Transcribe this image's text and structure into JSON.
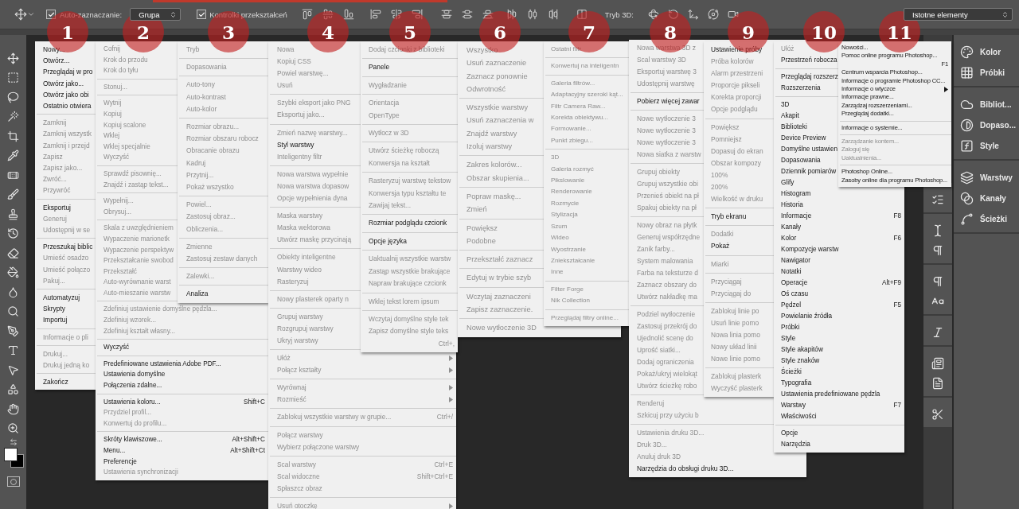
{
  "options_bar": {
    "auto_select": {
      "label": "Auto-zaznaczanie:",
      "checked": true
    },
    "auto_select_target": "Grupa",
    "transform_controls": {
      "label": "Kontrolki przekształceń",
      "checked": true
    },
    "mode_3d_label": "Tryb 3D:",
    "workspace": "Istotne elementy"
  },
  "annotations": [
    "1",
    "2",
    "3",
    "4",
    "5",
    "6",
    "7",
    "8",
    "9",
    "10",
    "11"
  ],
  "menus": [
    {
      "groups": [
        [
          {
            "label": "Nowy...",
            "disabled": false
          },
          {
            "label": "Otwórz...",
            "disabled": false
          },
          {
            "label": "Przeglądaj w pro",
            "disabled": false
          },
          {
            "label": "Otwórz jako...",
            "disabled": false
          },
          {
            "label": "Otwórz jako obi",
            "disabled": false
          },
          {
            "label": "Ostatnio otwiera",
            "disabled": false
          }
        ],
        [
          {
            "label": "Zamknij",
            "disabled": true
          },
          {
            "label": "Zamknij wszystk",
            "disabled": true
          },
          {
            "label": "Zamknij i przejd",
            "disabled": true
          },
          {
            "label": "Zapisz",
            "disabled": true
          },
          {
            "label": "Zapisz jako...",
            "disabled": true
          },
          {
            "label": "Zwróć...",
            "disabled": true
          },
          {
            "label": "Przywróć",
            "disabled": true
          }
        ],
        [
          {
            "label": "Eksportuj",
            "disabled": false
          },
          {
            "label": "Generuj",
            "disabled": true
          },
          {
            "label": "Udostępnij w se",
            "disabled": true
          }
        ],
        [
          {
            "label": "Przeszukaj biblic",
            "disabled": false
          },
          {
            "label": "Umieść osadzo",
            "disabled": true
          },
          {
            "label": "Umieść połączo",
            "disabled": true
          },
          {
            "label": "Pakuj...",
            "disabled": true
          }
        ],
        [
          {
            "label": "Automatyzuj",
            "disabled": false
          },
          {
            "label": "Skrypty",
            "disabled": false
          },
          {
            "label": "Importuj",
            "disabled": false
          }
        ],
        [
          {
            "label": "Informacje o pli",
            "disabled": true
          }
        ],
        [
          {
            "label": "Drukuj...",
            "disabled": true
          },
          {
            "label": "Drukuj jedną ko",
            "disabled": true
          }
        ],
        [
          {
            "label": "Zakończ",
            "disabled": false
          }
        ]
      ]
    },
    {
      "groups": [
        [
          {
            "label": "Cofnij",
            "disabled": true
          },
          {
            "label": "Krok do przodu",
            "disabled": true
          },
          {
            "label": "Krok do tyłu",
            "disabled": true
          }
        ],
        [
          {
            "label": "Stonuj...",
            "disabled": true
          }
        ],
        [
          {
            "label": "Wytnij",
            "disabled": true
          },
          {
            "label": "Kopiuj",
            "disabled": true
          },
          {
            "label": "Kopiuj scalone",
            "disabled": true
          },
          {
            "label": "Wklej",
            "disabled": true
          },
          {
            "label": "Wklej specjalnie",
            "disabled": true
          },
          {
            "label": "Wyczyść",
            "disabled": true
          }
        ],
        [
          {
            "label": "Sprawdź pisownię...",
            "disabled": true
          },
          {
            "label": "Znajdź i zastąp tekst...",
            "disabled": true
          }
        ],
        [
          {
            "label": "Wypełnij...",
            "disabled": true
          },
          {
            "label": "Obrysuj...",
            "disabled": true
          }
        ],
        [
          {
            "label": "Skala z uwzględnieniem",
            "disabled": true
          },
          {
            "label": "Wypaczenie marionetk",
            "disabled": true
          },
          {
            "label": "Wypaczenie perspektyw",
            "disabled": true
          },
          {
            "label": "Przekształcanie swobod",
            "disabled": true
          },
          {
            "label": "Przekształć",
            "disabled": true
          },
          {
            "label": "Auto-wyrównanie warst",
            "disabled": true
          },
          {
            "label": "Auto-mieszanie warstw",
            "disabled": true
          }
        ],
        [
          {
            "label": "Zdefiniuj ustawienie domyślne pędzla...",
            "disabled": true
          },
          {
            "label": "Zdefiniuj wzorek...",
            "disabled": true
          },
          {
            "label": "Zdefiniuj kształt własny...",
            "disabled": true
          }
        ],
        [
          {
            "label": "Wyczyść",
            "disabled": false
          }
        ],
        [
          {
            "label": "Predefiniowane ustawienia Adobe PDF...",
            "disabled": false
          },
          {
            "label": "Ustawienia domyślne",
            "disabled": false
          },
          {
            "label": "Połączenia zdalne...",
            "disabled": false
          }
        ],
        [
          {
            "label": "Ustawienia koloru...",
            "disabled": false,
            "shortcut": "Shift+C"
          },
          {
            "label": "Przydziel profil...",
            "disabled": true
          },
          {
            "label": "Konwertuj do profilu...",
            "disabled": true
          }
        ],
        [
          {
            "label": "Skróty klawiszowe...",
            "disabled": false,
            "shortcut": "Alt+Shift+C"
          },
          {
            "label": "Menu...",
            "disabled": false,
            "shortcut": "Alt+Shift+Ct"
          },
          {
            "label": "Preferencje",
            "disabled": false
          },
          {
            "label": "Ustawienia synchronizacji",
            "disabled": true
          }
        ]
      ]
    },
    {
      "groups": [
        [
          {
            "label": "Tryb",
            "disabled": true
          }
        ],
        [
          {
            "label": "Dopasowania",
            "disabled": true
          }
        ],
        [
          {
            "label": "Auto-tony",
            "disabled": true
          },
          {
            "label": "Auto-kontrast",
            "disabled": true
          },
          {
            "label": "Auto-kolor",
            "disabled": true
          }
        ],
        [
          {
            "label": "Rozmiar obrazu...",
            "disabled": true
          },
          {
            "label": "Rozmiar obszaru robocz",
            "disabled": true
          },
          {
            "label": "Obracanie obrazu",
            "disabled": true
          },
          {
            "label": "Kadruj",
            "disabled": true
          },
          {
            "label": "Przytnij...",
            "disabled": true
          },
          {
            "label": "Pokaż wszystko",
            "disabled": true
          }
        ],
        [
          {
            "label": "Powiel...",
            "disabled": true
          },
          {
            "label": "Zastosuj obraz...",
            "disabled": true
          },
          {
            "label": "Obliczenia...",
            "disabled": true
          }
        ],
        [
          {
            "label": "Zmienne",
            "disabled": true
          },
          {
            "label": "Zastosuj zestaw danych",
            "disabled": true
          }
        ],
        [
          {
            "label": "Zalewki...",
            "disabled": true
          }
        ],
        [
          {
            "label": "Analiza",
            "disabled": false
          }
        ]
      ]
    },
    {
      "groups": [
        [
          {
            "label": "Nowa",
            "disabled": true
          },
          {
            "label": "Kopiuj CSS",
            "disabled": true
          },
          {
            "label": "Powiel warstwę...",
            "disabled": true
          },
          {
            "label": "Usuń",
            "disabled": true
          }
        ],
        [
          {
            "label": "Szybki eksport jako PNG",
            "disabled": true
          },
          {
            "label": "Eksportuj jako...",
            "disabled": true
          }
        ],
        [
          {
            "label": "Zmień nazwę warstwy...",
            "disabled": true
          },
          {
            "label": "Styl warstwy",
            "disabled": false
          },
          {
            "label": "Inteligentny filtr",
            "disabled": true
          }
        ],
        [
          {
            "label": "Nowa warstwa wypełnie",
            "disabled": true
          },
          {
            "label": "Nowa warstwa dopasow",
            "disabled": true
          },
          {
            "label": "Opcje wypełnienia dyna",
            "disabled": true
          }
        ],
        [
          {
            "label": "Maska warstwy",
            "disabled": true
          },
          {
            "label": "Maska wektorowa",
            "disabled": true
          },
          {
            "label": "Utwórz maskę przycinają",
            "disabled": true
          }
        ],
        [
          {
            "label": "Obiekty inteligentne",
            "disabled": true
          },
          {
            "label": "Warstwy wideo",
            "disabled": true
          },
          {
            "label": "Rasteryzuj",
            "disabled": true
          }
        ],
        [
          {
            "label": "Nowy plasterek oparty n",
            "disabled": true
          }
        ],
        [
          {
            "label": "Grupuj warstwy",
            "disabled": true
          },
          {
            "label": "Rozgrupuj warstwy",
            "disabled": true
          },
          {
            "label": "Ukryj warstwy",
            "disabled": true
          }
        ],
        [
          {
            "label": "Ułóż",
            "disabled": true,
            "submenu": true
          },
          {
            "label": "Połącz kształty",
            "disabled": true,
            "submenu": true
          }
        ],
        [
          {
            "label": "Wyrównaj",
            "disabled": true,
            "submenu": true
          },
          {
            "label": "Rozmieść",
            "disabled": true,
            "submenu": true
          }
        ],
        [
          {
            "label": "Zablokuj wszystkie warstwy w grupie...",
            "disabled": true,
            "shortcut": "Ctrl+/"
          }
        ],
        [
          {
            "label": "Połącz warstwy",
            "disabled": true
          },
          {
            "label": "Wybierz połączone warstwy",
            "disabled": true
          }
        ],
        [
          {
            "label": "Scal warstwy",
            "disabled": true,
            "shortcut": "Ctrl+E"
          },
          {
            "label": "Scal widoczne",
            "disabled": true,
            "shortcut": "Shift+Ctrl+E"
          },
          {
            "label": "Spłaszcz obraz",
            "disabled": true
          }
        ],
        [
          {
            "label": "Usuń otoczkę",
            "disabled": true,
            "submenu": true
          }
        ]
      ]
    },
    {
      "groups": [
        [
          {
            "label": "Dodaj czcionki z biblioteki",
            "disabled": true
          }
        ],
        [
          {
            "label": "Panele",
            "disabled": false
          }
        ],
        [
          {
            "label": "Wygładzanie",
            "disabled": true
          }
        ],
        [
          {
            "label": "Orientacja",
            "disabled": true
          },
          {
            "label": "OpenType",
            "disabled": true
          }
        ],
        [
          {
            "label": "Wytłocz w 3D",
            "disabled": true
          }
        ],
        [
          {
            "label": "Utwórz ścieżkę roboczą",
            "disabled": true
          },
          {
            "label": "Konwersja na kształt",
            "disabled": true
          }
        ],
        [
          {
            "label": "Rasteryzuj warstwę tekstow",
            "disabled": true
          },
          {
            "label": "Konwersja typu kształtu te",
            "disabled": true
          },
          {
            "label": "Zawijaj tekst...",
            "disabled": true
          }
        ],
        [
          {
            "label": "Rozmiar podglądu czcionk",
            "disabled": false
          }
        ],
        [
          {
            "label": "Opcje języka",
            "disabled": false
          }
        ],
        [
          {
            "label": "Uaktualnij wszystkie warstw",
            "disabled": true
          },
          {
            "label": "Zastąp wszystkie brakujące",
            "disabled": true
          },
          {
            "label": "Napraw brakujące czcionk",
            "disabled": true
          }
        ],
        [
          {
            "label": "Wklej tekst lorem ipsum",
            "disabled": true
          }
        ],
        [
          {
            "label": "Wczytaj domyślne style tek",
            "disabled": true
          },
          {
            "label": "Zapisz domyślne style teks",
            "disabled": true,
            "shortcut": "Ctrl+,"
          }
        ]
      ]
    },
    {
      "groups": [
        [
          {
            "label": "Wszystko",
            "disabled": true
          },
          {
            "label": "Usuń zaznaczenie",
            "disabled": true
          },
          {
            "label": "Zaznacz ponownie",
            "disabled": true
          },
          {
            "label": "Odwrotność",
            "disabled": true
          }
        ],
        [
          {
            "label": "Wszystkie warstwy",
            "disabled": true
          },
          {
            "label": "Usuń zaznaczenia w",
            "disabled": true
          },
          {
            "label": "Znajdź warstwy",
            "disabled": true
          },
          {
            "label": "Izoluj warstwy",
            "disabled": true
          }
        ],
        [
          {
            "label": "Zakres kolorów...",
            "disabled": true
          },
          {
            "label": "Obszar skupienia...",
            "disabled": true
          }
        ],
        [
          {
            "label": "Popraw maskę...",
            "disabled": true
          },
          {
            "label": "Zmień",
            "disabled": true
          }
        ],
        [
          {
            "label": "Powiększ",
            "disabled": true
          },
          {
            "label": "Podobne",
            "disabled": true
          }
        ],
        [
          {
            "label": "Przekształć zaznacz",
            "disabled": true
          }
        ],
        [
          {
            "label": "Edytuj w trybie szyb",
            "disabled": true
          }
        ],
        [
          {
            "label": "Wczytaj zaznaczeni",
            "disabled": true
          },
          {
            "label": "Zapisz zaznaczenie.",
            "disabled": true
          }
        ],
        [
          {
            "label": "Nowe wytłoczenie 3D",
            "disabled": true
          }
        ]
      ]
    },
    {
      "groups": [
        [
          {
            "label": "Ostatni filtr",
            "disabled": true
          }
        ],
        [
          {
            "label": "Konwertuj na inteligentn",
            "disabled": true
          }
        ],
        [
          {
            "label": "Galeria filtrów...",
            "disabled": true
          },
          {
            "label": "Adaptacyjny szeroki kąt...",
            "disabled": true
          },
          {
            "label": "Filtr Camera Raw...",
            "disabled": true
          },
          {
            "label": "Korekta obiektywu...",
            "disabled": true
          },
          {
            "label": "Formowanie...",
            "disabled": true
          },
          {
            "label": "Punkt zbiegu...",
            "disabled": true
          }
        ],
        [
          {
            "label": "3D",
            "disabled": true
          },
          {
            "label": "Galeria rozmyć",
            "disabled": true
          },
          {
            "label": "Pikslowanie",
            "disabled": true
          },
          {
            "label": "Renderowanie",
            "disabled": true
          },
          {
            "label": "Rozmycie",
            "disabled": true
          },
          {
            "label": "Stylizacja",
            "disabled": true
          },
          {
            "label": "Szum",
            "disabled": true
          },
          {
            "label": "Wideo",
            "disabled": true
          },
          {
            "label": "Wyostrzanie",
            "disabled": true
          },
          {
            "label": "Zniekształcanie",
            "disabled": true
          },
          {
            "label": "Inne",
            "disabled": true
          }
        ],
        [
          {
            "label": "Filter Forge",
            "disabled": true
          },
          {
            "label": "Nik Collection",
            "disabled": true
          }
        ],
        [
          {
            "label": "Przeglądaj filtry online...",
            "disabled": true
          }
        ]
      ]
    },
    {
      "groups": [
        [
          {
            "label": "Nowa warstwa 3D z",
            "disabled": true
          },
          {
            "label": "Scal warstwy 3D",
            "disabled": true
          },
          {
            "label": "Eksportuj warstwę 3",
            "disabled": true
          },
          {
            "label": "Udostępnij warstwę",
            "disabled": true
          }
        ],
        [
          {
            "label": "Pobierz więcej zawar",
            "disabled": false
          }
        ],
        [
          {
            "label": "Nowe wytłoczenie 3",
            "disabled": true
          },
          {
            "label": "Nowe wytłoczenie 3",
            "disabled": true
          },
          {
            "label": "Nowe wytłoczenie 3",
            "disabled": true
          },
          {
            "label": "Nowa siatka z warstw",
            "disabled": true
          }
        ],
        [
          {
            "label": "Grupuj obiekty",
            "disabled": true
          },
          {
            "label": "Grupuj wszystkie obi",
            "disabled": true
          },
          {
            "label": "Przenieś obiekt na pł",
            "disabled": true
          },
          {
            "label": "Spakuj obiekty na pł",
            "disabled": true
          }
        ],
        [
          {
            "label": "Nowy obraz na płytk",
            "disabled": true
          },
          {
            "label": "Generuj współrzędne",
            "disabled": true
          },
          {
            "label": "Zanik farby...",
            "disabled": true
          },
          {
            "label": "System malowania",
            "disabled": true
          },
          {
            "label": "Farba na teksturze d",
            "disabled": true
          },
          {
            "label": "Zaznacz obszary do",
            "disabled": true
          },
          {
            "label": "Utwórz nakładkę ma",
            "disabled": true
          }
        ],
        [
          {
            "label": "Podziel wytłoczenie",
            "disabled": true
          },
          {
            "label": "Zastosuj przekrój do",
            "disabled": true
          },
          {
            "label": "Ujednolić scenę do",
            "disabled": true
          },
          {
            "label": "Uprość siatki...",
            "disabled": true
          },
          {
            "label": "Dodaj ograniczenia",
            "disabled": true
          },
          {
            "label": "Pokaż/ukryj wielokąt",
            "disabled": true
          },
          {
            "label": "Utwórz ścieżkę robo",
            "disabled": true
          }
        ],
        [
          {
            "label": "Renderuj",
            "disabled": true
          },
          {
            "label": "Szkicuj przy użyciu b",
            "disabled": true
          }
        ],
        [
          {
            "label": "Ustawienia druku 3D...",
            "disabled": true
          },
          {
            "label": "Druk 3D...",
            "disabled": true
          },
          {
            "label": "Anuluj druk 3D",
            "disabled": true
          },
          {
            "label": "Narzędzia do obsługi druku 3D...",
            "disabled": false
          }
        ]
      ]
    },
    {
      "groups": [
        [
          {
            "label": "Ustawienie próby",
            "disabled": false
          },
          {
            "label": "Próba kolorów",
            "disabled": true
          },
          {
            "label": "Alarm przestrzeni",
            "disabled": true
          },
          {
            "label": "Proporcje pikseli",
            "disabled": true
          },
          {
            "label": "Korekta proporcji",
            "disabled": true
          },
          {
            "label": "Opcje podglądu",
            "disabled": true
          }
        ],
        [
          {
            "label": "Powiększ",
            "disabled": true
          },
          {
            "label": "Pomniejsz",
            "disabled": true
          },
          {
            "label": "Dopasuj do ekran",
            "disabled": true
          },
          {
            "label": "Obszar kompozy",
            "disabled": true
          },
          {
            "label": "100%",
            "disabled": true
          },
          {
            "label": "200%",
            "disabled": true
          },
          {
            "label": "Wielkość w druku",
            "disabled": true
          }
        ],
        [
          {
            "label": "Tryb ekranu",
            "disabled": false
          }
        ],
        [
          {
            "label": "Dodatki",
            "disabled": true
          },
          {
            "label": "Pokaż",
            "disabled": false
          }
        ],
        [
          {
            "label": "Miarki",
            "disabled": true
          }
        ],
        [
          {
            "label": "Przyciągaj",
            "disabled": true
          },
          {
            "label": "Przyciągaj do",
            "disabled": true
          }
        ],
        [
          {
            "label": "Zablokuj linie po",
            "disabled": true
          },
          {
            "label": "Usuń linie pomo",
            "disabled": true
          },
          {
            "label": "Nowa linia pomo",
            "disabled": true
          },
          {
            "label": "Nowy układ linii",
            "disabled": true
          },
          {
            "label": "Nowe linie pomo",
            "disabled": true
          }
        ],
        [
          {
            "label": "Zablokuj plasterk",
            "disabled": true
          },
          {
            "label": "Wyczyść plasterk",
            "disabled": true
          }
        ]
      ]
    },
    {
      "groups": [
        [
          {
            "label": "Ułóż",
            "disabled": true
          },
          {
            "label": "Przestrzeń robocza",
            "disabled": false
          }
        ],
        [
          {
            "label": "Przeglądaj rozszerz",
            "disabled": false
          },
          {
            "label": "Rozszerzenia",
            "disabled": false
          }
        ],
        [
          {
            "label": "3D",
            "disabled": false
          },
          {
            "label": "Akapit",
            "disabled": false
          },
          {
            "label": "Biblioteki",
            "disabled": false
          },
          {
            "label": "Device Preview",
            "disabled": false
          },
          {
            "label": "Domyślne ustawien",
            "disabled": false
          },
          {
            "label": "Dopasowania",
            "disabled": false
          },
          {
            "label": "Dziennik pomiarów",
            "disabled": false
          },
          {
            "label": "Glify",
            "disabled": false
          },
          {
            "label": "Histogram",
            "disabled": false
          },
          {
            "label": "Historia",
            "disabled": false
          },
          {
            "label": "Informacje",
            "disabled": false,
            "shortcut": "F8"
          },
          {
            "label": "Kanały",
            "disabled": false
          },
          {
            "label": "Kolor",
            "disabled": false,
            "shortcut": "F6"
          },
          {
            "label": "Kompozycje warstw",
            "disabled": false
          },
          {
            "label": "Nawigator",
            "disabled": false
          },
          {
            "label": "Notatki",
            "disabled": false
          },
          {
            "label": "Operacje",
            "disabled": false,
            "shortcut": "Alt+F9"
          },
          {
            "label": "Oś czasu",
            "disabled": false
          },
          {
            "label": "Pędzel",
            "disabled": false,
            "shortcut": "F5"
          },
          {
            "label": "Powielanie źródła",
            "disabled": false
          },
          {
            "label": "Próbki",
            "disabled": false
          },
          {
            "label": "Style",
            "disabled": false
          },
          {
            "label": "Style akapitów",
            "disabled": false
          },
          {
            "label": "Style znaków",
            "disabled": false
          },
          {
            "label": "Ścieżki",
            "disabled": false
          },
          {
            "label": "Typografia",
            "disabled": false
          },
          {
            "label": "Ustawienia predefiniowane pędzla",
            "disabled": false
          },
          {
            "label": "Warstwy",
            "disabled": false,
            "shortcut": "F7"
          },
          {
            "label": "Właściwości",
            "disabled": false
          }
        ],
        [
          {
            "label": "Opcje",
            "disabled": false
          },
          {
            "label": "Narzędzia",
            "disabled": false
          }
        ]
      ]
    },
    {
      "groups": [
        [
          {
            "label": "Nowości...",
            "disabled": false
          },
          {
            "label": "Pomoc online programu Photoshop...",
            "disabled": false,
            "shortcut": "F1"
          },
          {
            "label": "Centrum wsparcia Photoshop...",
            "disabled": false
          },
          {
            "label": "Informacje o programie Photoshop CC...",
            "disabled": false
          },
          {
            "label": "Informacje o wtyczce",
            "disabled": false,
            "submenu": true
          },
          {
            "label": "Informacje prawne...",
            "disabled": false
          },
          {
            "label": "Zarządzaj rozszerzeniami...",
            "disabled": false
          },
          {
            "label": "Przeglądaj dodatki...",
            "disabled": false
          }
        ],
        [
          {
            "label": "Informacje o systemie...",
            "disabled": false
          }
        ],
        [
          {
            "label": "Zarządzanie kontem...",
            "disabled": true
          },
          {
            "label": "Zaloguj się",
            "disabled": true
          },
          {
            "label": "Uaktualnienia...",
            "disabled": true
          }
        ],
        [
          {
            "label": "Photoshop Online...",
            "disabled": false
          },
          {
            "label": "Zasoby online dla programu Photoshop...",
            "disabled": false
          }
        ]
      ]
    }
  ],
  "panels": [
    [
      {
        "label": "Kolor"
      },
      {
        "label": "Próbki"
      }
    ],
    [
      {
        "label": "Bibliot..."
      },
      {
        "label": "Dopaso..."
      },
      {
        "label": "Style"
      }
    ],
    [
      {
        "label": "Warstwy"
      },
      {
        "label": "Kanały"
      },
      {
        "label": "Ścieżki"
      }
    ]
  ]
}
